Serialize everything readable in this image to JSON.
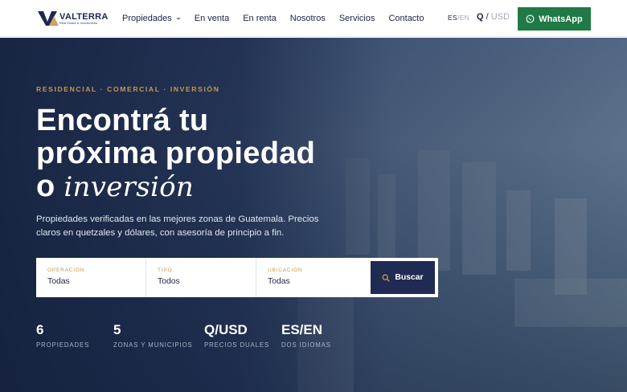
{
  "brand": {
    "name": "VALTERRA",
    "tagline": "Real Estate & Investments"
  },
  "nav": {
    "items": [
      {
        "label": "Propiedades",
        "has_dropdown": true
      },
      {
        "label": "En venta"
      },
      {
        "label": "En renta"
      },
      {
        "label": "Nosotros"
      },
      {
        "label": "Servicios"
      },
      {
        "label": "Contacto"
      }
    ],
    "lang_active": "ES",
    "lang_sep": "/",
    "lang_inactive": "EN",
    "curr_active": "Q",
    "curr_sep": "/",
    "curr_inactive": "USD",
    "whatsapp_label": "WhatsApp"
  },
  "hero": {
    "eyebrow": "RESIDENCIAL · COMERCIAL · INVERSIÓN",
    "title_line1": "Encontrá tu",
    "title_line2": "próxima propiedad",
    "title_line3_plain": "o",
    "title_line3_italic": "inversión",
    "subtitle": "Propiedades verificadas en las mejores zonas de Guatemala. Precios claros en quetzales y dólares, con asesoría de principio a fin."
  },
  "search": {
    "fields": [
      {
        "label": "OPERACIÓN",
        "value": "Todas"
      },
      {
        "label": "TIPO",
        "value": "Todos"
      },
      {
        "label": "UBICACIÓN",
        "value": "Todas"
      }
    ],
    "button_label": "Buscar"
  },
  "stats": [
    {
      "value": "6",
      "label": "PROPIEDADES"
    },
    {
      "value": "5",
      "label": "ZONAS Y MUNICIPIOS"
    },
    {
      "value": "Q/USD",
      "label": "PRECIOS DUALES"
    },
    {
      "value": "ES/EN",
      "label": "DOS IDIOMAS"
    }
  ],
  "colors": {
    "navy": "#1f2b52",
    "gold": "#c79a4b",
    "whatsapp_green": "#1f7a45"
  }
}
